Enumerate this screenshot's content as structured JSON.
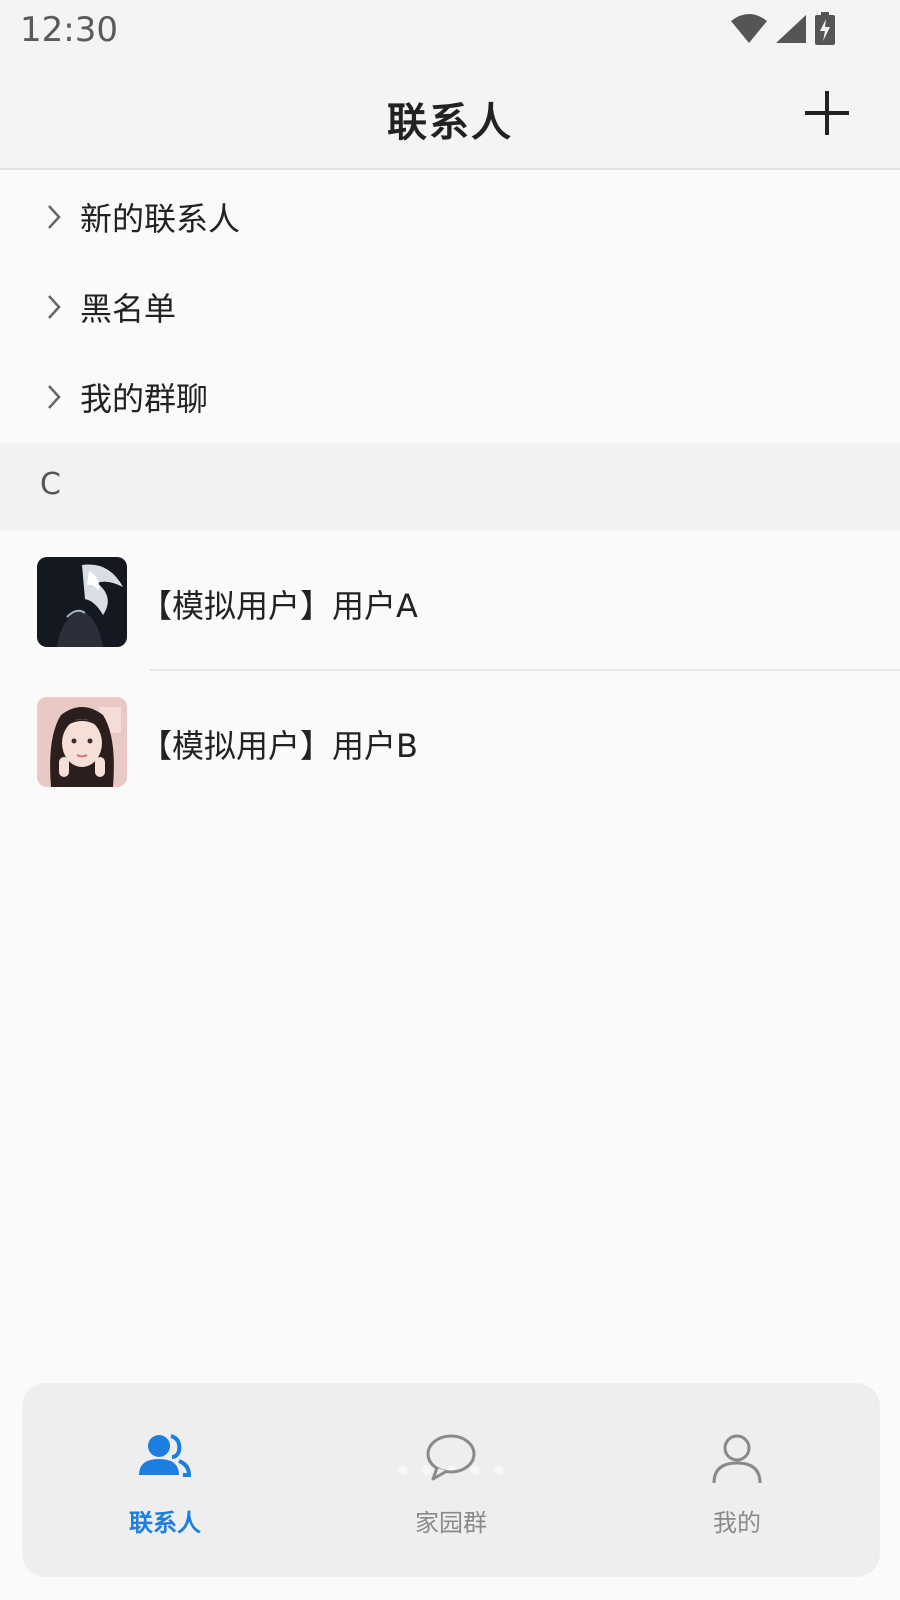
{
  "status_bar": {
    "time": "12:30",
    "icons": [
      "wifi-icon",
      "signal-icon",
      "battery-charging-icon"
    ]
  },
  "header": {
    "title": "联系人",
    "add_icon": "plus-icon"
  },
  "menu": [
    {
      "label": "新的联系人",
      "icon": "chevron-right-icon"
    },
    {
      "label": "黑名单",
      "icon": "chevron-right-icon"
    },
    {
      "label": "我的群聊",
      "icon": "chevron-right-icon"
    }
  ],
  "section": {
    "letter": "C"
  },
  "contacts": [
    {
      "name": "【模拟用户】用户A",
      "avatar": "avatar-dark-anime"
    },
    {
      "name": "【模拟用户】用户B",
      "avatar": "avatar-girl-photo"
    }
  ],
  "bottom_nav": {
    "items": [
      {
        "label": "联系人",
        "icon": "contacts-icon",
        "active": true
      },
      {
        "label": "家园群",
        "icon": "chat-bubble-icon",
        "active": false
      },
      {
        "label": "我的",
        "icon": "person-icon",
        "active": false
      }
    ]
  },
  "colors": {
    "accent": "#1c7ee0",
    "background": "#fafafa",
    "header_bg": "#f4f4f4",
    "section_bg": "#f2f2f4"
  }
}
